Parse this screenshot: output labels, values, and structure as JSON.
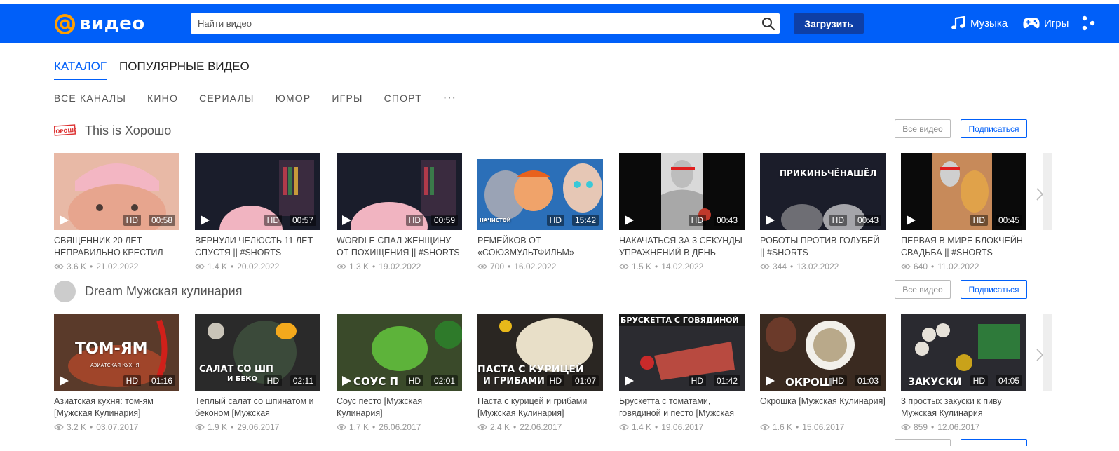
{
  "header": {
    "logo_text": "видео",
    "search_placeholder": "Найти видео",
    "upload_label": "Загрузить",
    "music_label": "Музыка",
    "games_label": "Игры",
    "brand_color": "#005ff9"
  },
  "tabs": [
    {
      "label": "КАТАЛОГ",
      "active": true
    },
    {
      "label": "ПОПУЛЯРНЫЕ ВИДЕО",
      "active": false
    }
  ],
  "categories": [
    "ВСЕ КАНАЛЫ",
    "КИНО",
    "СЕРИАЛЫ",
    "ЮМОР",
    "ИГРЫ",
    "СПОРТ"
  ],
  "categories_more": "···",
  "sections": [
    {
      "channel": "This is Хорошо",
      "channel_logo_text": "ХОРОШО",
      "all_label": "Все видео",
      "subscribe_label": "Подписаться",
      "videos": [
        {
          "title": "СВЯЩЕННИК 20 ЛЕТ НЕПРАВИЛЬНО КРЕСТИЛ",
          "views": "3.6 K",
          "date": "21.02.2022",
          "hd": "HD",
          "duration": "00:58",
          "overlay": ""
        },
        {
          "title": "ВЕРНУЛИ ЧЕЛЮСТЬ 11 ЛЕТ СПУСТЯ || #shorts",
          "views": "1.4 K",
          "date": "20.02.2022",
          "hd": "HD",
          "duration": "00:57",
          "overlay": ""
        },
        {
          "title": "WORDLE СПАЛ ЖЕНЩИНУ ОТ ПОХИЩЕНИЯ || #shorts",
          "views": "1.3 K",
          "date": "19.02.2022",
          "hd": "HD",
          "duration": "00:59",
          "overlay": ""
        },
        {
          "title": "РЕМЕЙКОВ ОТ «СОЮЗМУЛЬТФИЛЬМ»",
          "views": "700",
          "date": "16.02.2022",
          "hd": "HD",
          "duration": "15:42",
          "overlay": "НАЧИСТОЙ"
        },
        {
          "title": "НАКАЧАТЬСЯ ЗА 3 СЕКУНДЫ УПРАЖНЕНИЙ В ДЕНЬ",
          "views": "1.5 K",
          "date": "14.02.2022",
          "hd": "HD",
          "duration": "00:43",
          "overlay": ""
        },
        {
          "title": "РОБОТЫ ПРОТИВ ГОЛУБЕЙ || #shorts",
          "views": "344",
          "date": "13.02.2022",
          "hd": "HD",
          "duration": "00:43",
          "overlay": "ПРИКИНЬЧЁНАШЁЛ"
        },
        {
          "title": "ПЕРВАЯ В МИРЕ БЛОКЧЕЙН СВАДЬБА || #shorts",
          "views": "640",
          "date": "11.02.2022",
          "hd": "HD",
          "duration": "00:45",
          "overlay": ""
        }
      ]
    },
    {
      "channel": "Dream Мужская кулинария",
      "all_label": "Все видео",
      "subscribe_label": "Подписаться",
      "videos": [
        {
          "title": "Азиатская кухня: том-ям [Мужская Кулинария]",
          "views": "3.2 K",
          "date": "03.07.2017",
          "hd": "HD",
          "duration": "01:16",
          "overlay": "ТОМ-ЯМ",
          "overlay2": "АЗИАТСКАЯ КУХНЯ"
        },
        {
          "title": "Теплый салат со шпинатом и беконом [Мужская",
          "views": "1.9 K",
          "date": "29.06.2017",
          "hd": "HD",
          "duration": "02:11",
          "overlay": "САЛАТ СО ШП",
          "overlay2": "И БЕКО"
        },
        {
          "title": "Соус песто [Мужская Кулинария]",
          "views": "1.7 K",
          "date": "26.06.2017",
          "hd": "HD",
          "duration": "02:01",
          "overlay": "СОУС П"
        },
        {
          "title": "Паста с курицей и грибами [Мужская Кулинария]",
          "views": "2.4 K",
          "date": "22.06.2017",
          "hd": "HD",
          "duration": "01:07",
          "overlay": "ПАСТА С КУРИЦЕЙ",
          "overlay2": "И ГРИБАМИ"
        },
        {
          "title": "Брускетта с томатами, говядиной и песто [Мужская",
          "views": "1.4 K",
          "date": "19.06.2017",
          "hd": "HD",
          "duration": "01:42",
          "overlay": "БРУСКЕТТА С ГОВЯДИНОЙ"
        },
        {
          "title": "Окрошка [Мужская Кулинария]",
          "views": "1.6 K",
          "date": "15.06.2017",
          "hd": "HD",
          "duration": "01:03",
          "overlay": "ОКРОШ"
        },
        {
          "title": "3 простых закуски к пиву Мужская Кулинария",
          "views": "859",
          "date": "12.06.2017",
          "hd": "HD",
          "duration": "04:05",
          "overlay": "ЗАКУСКИ"
        }
      ]
    }
  ]
}
